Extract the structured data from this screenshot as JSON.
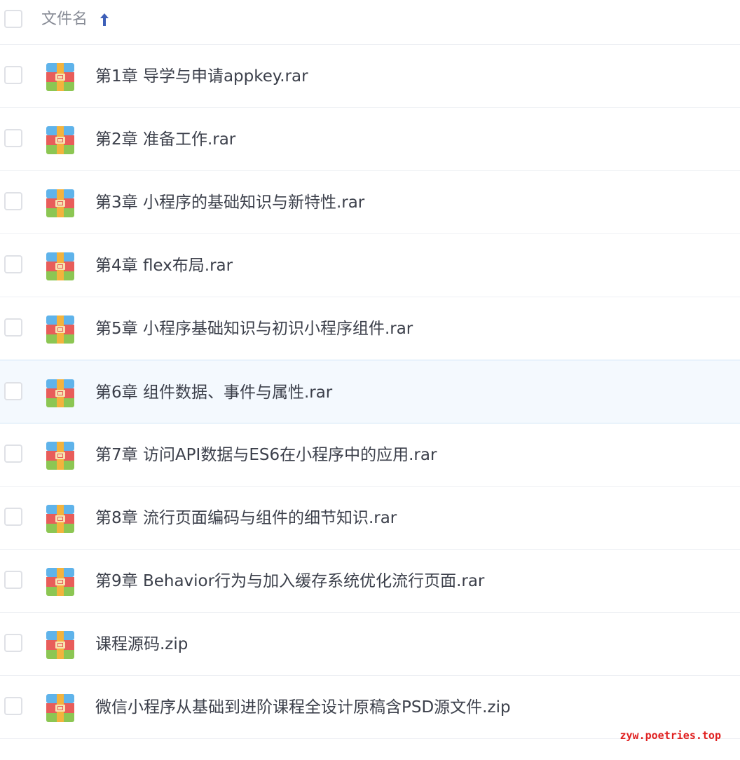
{
  "header": {
    "column_label": "文件名",
    "sort_direction": "ascending"
  },
  "files": [
    {
      "name": "第1章 导学与申请appkey.rar",
      "icon": "archive-icon",
      "selected": false
    },
    {
      "name": "第2章 准备工作.rar",
      "icon": "archive-icon",
      "selected": false
    },
    {
      "name": "第3章 小程序的基础知识与新特性.rar",
      "icon": "archive-icon",
      "selected": false
    },
    {
      "name": "第4章 flex布局.rar",
      "icon": "archive-icon",
      "selected": false
    },
    {
      "name": "第5章 小程序基础知识与初识小程序组件.rar",
      "icon": "archive-icon",
      "selected": false
    },
    {
      "name": "第6章 组件数据、事件与属性.rar",
      "icon": "archive-icon",
      "selected": true
    },
    {
      "name": "第7章 访问API数据与ES6在小程序中的应用.rar",
      "icon": "archive-icon",
      "selected": false
    },
    {
      "name": "第8章 流行页面编码与组件的细节知识.rar",
      "icon": "archive-icon",
      "selected": false
    },
    {
      "name": "第9章 Behavior行为与加入缓存系统优化流行页面.rar",
      "icon": "archive-icon",
      "selected": false
    },
    {
      "name": "课程源码.zip",
      "icon": "archive-icon",
      "selected": false
    },
    {
      "name": "微信小程序从基础到进阶课程全设计原稿含PSD源文件.zip",
      "icon": "archive-icon",
      "selected": false
    }
  ],
  "watermark": "zyw.poetries.top",
  "colors": {
    "sort_arrow": "#3d5fb8",
    "text": "#3b3f4a",
    "header_text": "#888c96",
    "selected_row": "#f4f9fe",
    "watermark": "#e02020"
  }
}
